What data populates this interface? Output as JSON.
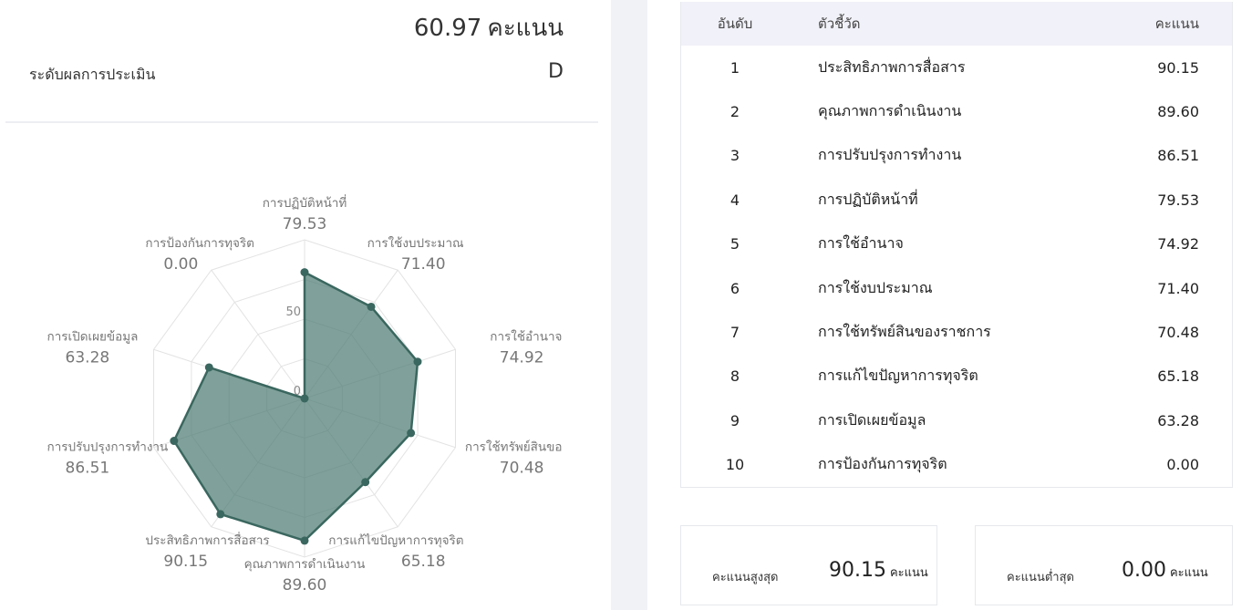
{
  "summary": {
    "total_score": "60.97",
    "score_unit": "คะแนน",
    "level_label": "ระดับผลการประเมิน",
    "level_value": "D"
  },
  "chart_data": {
    "type": "radar",
    "axes": [
      "การปฏิบัติหน้าที่",
      "การใช้งบประมาณ",
      "การใช้อำนาจ",
      "การใช้ทรัพย์สินของราชการ",
      "การแก้ไขปัญหาการทุจริต",
      "คุณภาพการดำเนินงาน",
      "ประสิทธิภาพการสื่อสาร",
      "การปรับปรุงการทำงาน",
      "การเปิดเผยข้อมูล",
      "การป้องกันการทุจริต"
    ],
    "axis_labels_display": [
      "การปฏิบัติหน้าที่",
      "การใช้งบประมาณ",
      "การใช้อำนาจ",
      "การใช้ทรัพย์สินขอ",
      "การแก้ไขปัญหาการทุจริต",
      "คุณภาพการดำเนินงาน",
      "ประสิทธิภาพการสื่อสาร",
      "การปรับปรุงการทำงาน",
      "การเปิดเผยข้อมูล",
      "การป้องกันการทุจริต"
    ],
    "values": [
      79.53,
      71.4,
      74.92,
      70.48,
      65.18,
      89.6,
      90.15,
      86.51,
      63.28,
      0.0
    ],
    "value_labels": [
      "79.53",
      "71.40",
      "74.92",
      "70.48",
      "65.18",
      "89.60",
      "90.15",
      "86.51",
      "63.28",
      "0.00"
    ],
    "rlim": [
      0,
      100
    ],
    "ticks": [
      0,
      50
    ],
    "tick_labels": [
      "0",
      "50"
    ],
    "fill_color": "#4f7d75",
    "line_color": "#3a675f",
    "grid_color": "#e3e3e3"
  },
  "ranking": {
    "headers": {
      "rank": "อันดับ",
      "indicator": "ตัวชี้วัด",
      "score": "คะแนน"
    },
    "rows": [
      {
        "rank": "1",
        "indicator": "ประสิทธิภาพการสื่อสาร",
        "score": "90.15"
      },
      {
        "rank": "2",
        "indicator": "คุณภาพการดำเนินงาน",
        "score": "89.60"
      },
      {
        "rank": "3",
        "indicator": "การปรับปรุงการทำงาน",
        "score": "86.51"
      },
      {
        "rank": "4",
        "indicator": "การปฏิบัติหน้าที่",
        "score": "79.53"
      },
      {
        "rank": "5",
        "indicator": "การใช้อำนาจ",
        "score": "74.92"
      },
      {
        "rank": "6",
        "indicator": "การใช้งบประมาณ",
        "score": "71.40"
      },
      {
        "rank": "7",
        "indicator": "การใช้ทรัพย์สินของราชการ",
        "score": "70.48"
      },
      {
        "rank": "8",
        "indicator": "การแก้ไขปัญหาการทุจริต",
        "score": "65.18"
      },
      {
        "rank": "9",
        "indicator": "การเปิดเผยข้อมูล",
        "score": "63.28"
      },
      {
        "rank": "10",
        "indicator": "การป้องกันการทุจริต",
        "score": "0.00"
      }
    ]
  },
  "stats": {
    "high_label": "คะแนนสูงสุด",
    "high_value": "90.15",
    "low_label": "คะแนนต่ำสุด",
    "low_value": "0.00",
    "unit": "คะแนน"
  }
}
